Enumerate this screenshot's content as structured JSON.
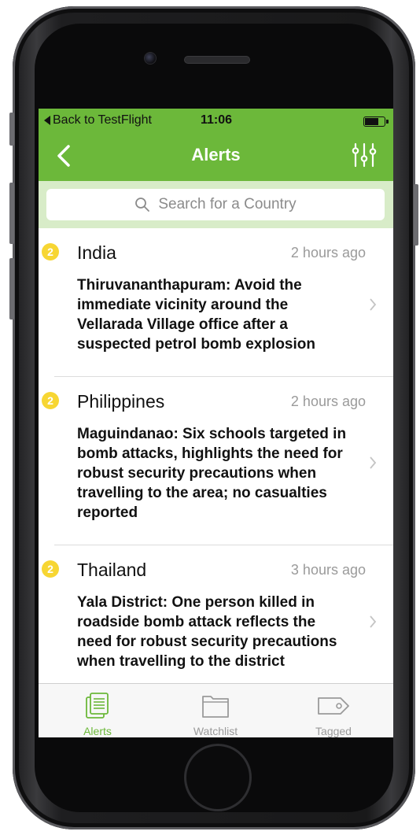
{
  "status_bar": {
    "back_label": "Back to TestFlight",
    "time": "11:06"
  },
  "nav": {
    "title": "Alerts"
  },
  "search": {
    "placeholder": "Search for a Country"
  },
  "alerts": [
    {
      "level": "2",
      "country": "India",
      "time": "2 hours ago",
      "text": "Thiruvananthapuram: Avoid the immediate vicinity around the Vellarada Village office after a suspected petrol bomb explosion"
    },
    {
      "level": "2",
      "country": "Philippines",
      "time": "2 hours ago",
      "text": "Maguindanao: Six schools targeted in bomb attacks, highlights the need for robust security precautions when travelling to the area; no casualties reported"
    },
    {
      "level": "2",
      "country": "Thailand",
      "time": "3 hours ago",
      "text": "Yala District: One person killed in roadside bomb attack reflects the need for robust security precautions when travelling to the district"
    }
  ],
  "tabs": [
    {
      "label": "Alerts",
      "icon": "document-icon",
      "active": true
    },
    {
      "label": "Watchlist",
      "icon": "folder-icon",
      "active": false
    },
    {
      "label": "Tagged",
      "icon": "tag-icon",
      "active": false
    }
  ],
  "colors": {
    "brand_green": "#6cb83a",
    "badge_yellow": "#f7d633",
    "search_bg": "#d8ecc8"
  }
}
